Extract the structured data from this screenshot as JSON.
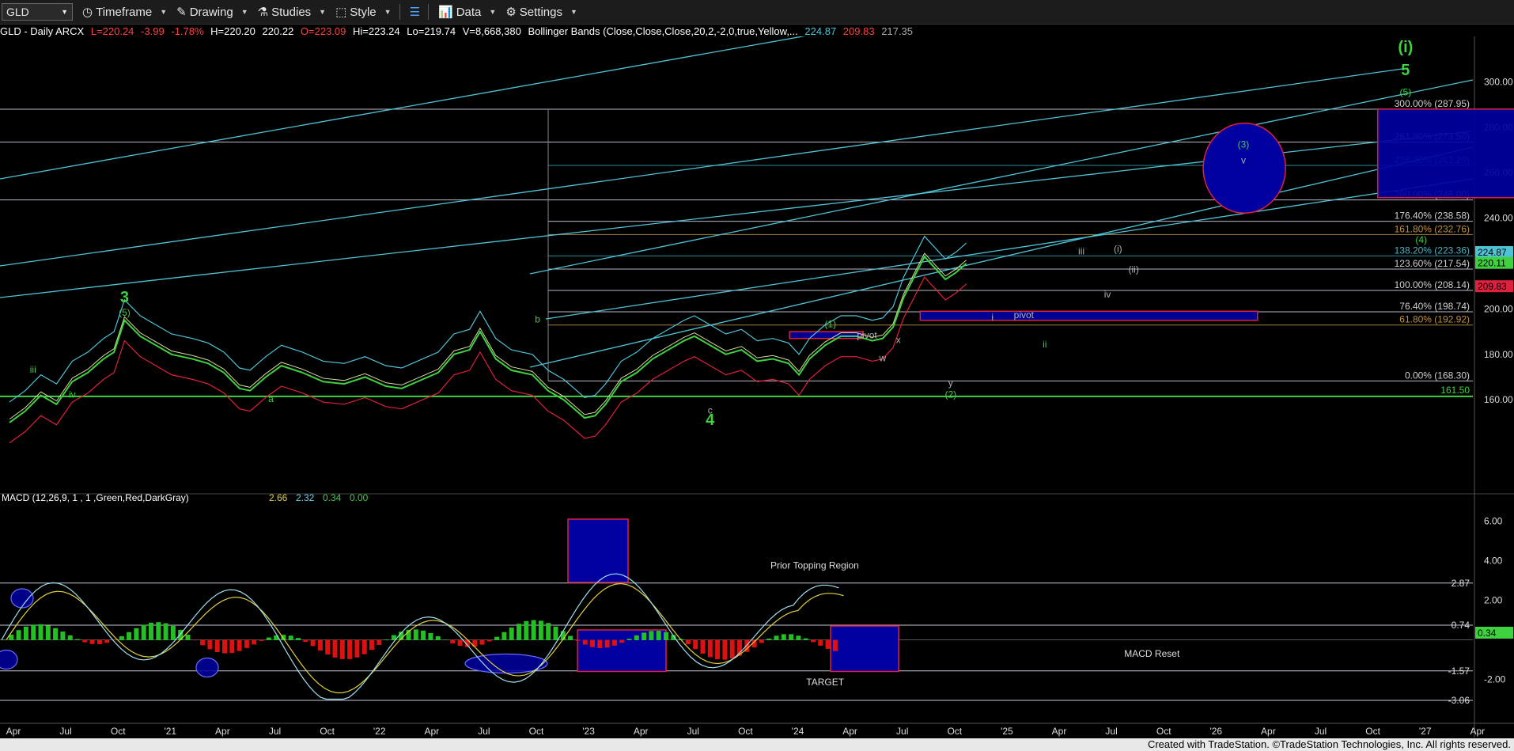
{
  "toolbar": {
    "symbol": "GLD",
    "timeframe": "Timeframe",
    "drawing": "Drawing",
    "studies": "Studies",
    "style": "Style",
    "data": "Data",
    "settings": "Settings"
  },
  "info": {
    "name": "GLD - Daily  ARCX",
    "last": "L=220.24",
    "chg": "-3.99",
    "pct": "-1.78%",
    "bid": "H=220.20",
    "ask": "220.22",
    "open": "O=223.09",
    "high": "Hi=223.24",
    "low": "Lo=219.74",
    "vol": "V=8,668,380",
    "bb": "Bollinger Bands (Close,Close,Close,20,2,-2,0,true,Yellow,...",
    "bb_up": "224.87",
    "bb_low": "209.83",
    "bb_mid": "217.35"
  },
  "footer": "Created with TradeStation. ©TradeStation Technologies, Inc. All rights reserved.",
  "colors": {
    "green": "#3fd13f",
    "cyan": "#4fc3d6",
    "blue": "#0000a0",
    "red": "#e0203c",
    "yellow": "#e0d040",
    "gray": "#b0b0b0"
  },
  "chart_data": [
    {
      "type": "line",
      "title": "",
      "ylim": [
        120,
        320
      ],
      "y_ticks": [
        160,
        180,
        200,
        220,
        240,
        260,
        280,
        300
      ],
      "x_ticks": [
        "Apr",
        "Jul",
        "Oct",
        "'21",
        "Apr",
        "Jul",
        "Oct",
        "'22",
        "Apr",
        "Jul",
        "Oct",
        "'23",
        "Apr",
        "Jul",
        "Oct",
        "'24",
        "Apr",
        "Jul",
        "Oct",
        "'25",
        "Apr",
        "Jul",
        "Oct",
        "'26",
        "Apr",
        "Jul",
        "Oct",
        "'27",
        "Apr"
      ],
      "fib_levels": [
        {
          "pct": "300.00%",
          "value": 287.95,
          "label": "300.00% (287.95)"
        },
        {
          "pct": "261.80%",
          "value": 273.5,
          "label": "261.80% (273.50)"
        },
        {
          "pct": "238.20%",
          "value": 263.2,
          "label": "238.20% (263.20)"
        },
        {
          "pct": "200.00%",
          "value": 248.0,
          "label": "200.00% (248.00)"
        },
        {
          "pct": "176.40%",
          "value": 238.58,
          "label": "176.40% (238.58)"
        },
        {
          "pct": "161.80%",
          "value": 232.76,
          "label": "161.80% (232.76)"
        },
        {
          "pct": "138.20%",
          "value": 223.36,
          "label": "138.20% (223.36)"
        },
        {
          "pct": "123.60%",
          "value": 217.54,
          "label": "123.60% (217.54)"
        },
        {
          "pct": "100.00%",
          "value": 208.14,
          "label": "100.00% (208.14)"
        },
        {
          "pct": "76.40%",
          "value": 198.74,
          "label": "76.40% (198.74)"
        },
        {
          "pct": "61.80%",
          "value": 192.92,
          "label": "61.80% (192.92)"
        },
        {
          "pct": "0.00%",
          "value": 168.3,
          "label": "0.00% (168.30)"
        }
      ],
      "support_line": {
        "value": 161.5,
        "label": "161.50"
      },
      "price_badges": [
        {
          "value": 224.87,
          "label": "224.87",
          "color": "#4fc3d6"
        },
        {
          "value": 220.11,
          "label": "220.11",
          "color": "#3fd13f"
        },
        {
          "value": 209.83,
          "label": "209.83",
          "color": "#e0203c"
        }
      ],
      "series": [
        {
          "values": [
            [
              0.0,
              150
            ],
            [
              0.3,
              155
            ],
            [
              0.6,
              162
            ],
            [
              0.9,
              158
            ],
            [
              1.2,
              168
            ],
            [
              1.5,
              172
            ],
            [
              1.8,
              178
            ],
            [
              2.0,
              181
            ],
            [
              2.2,
              195
            ],
            [
              2.5,
              188
            ],
            [
              2.8,
              184
            ],
            [
              3.1,
              180
            ],
            [
              3.5,
              178
            ],
            [
              3.8,
              176
            ],
            [
              4.1,
              172
            ],
            [
              4.4,
              165
            ],
            [
              4.6,
              164
            ],
            [
              4.9,
              170
            ],
            [
              5.2,
              175
            ],
            [
              5.6,
              172
            ],
            [
              6.0,
              168
            ],
            [
              6.4,
              167
            ],
            [
              6.8,
              170
            ],
            [
              7.2,
              166
            ],
            [
              7.5,
              165
            ],
            [
              7.8,
              168
            ],
            [
              8.2,
              172
            ],
            [
              8.5,
              180
            ],
            [
              8.8,
              182
            ],
            [
              9.0,
              190
            ],
            [
              9.3,
              178
            ],
            [
              9.6,
              173
            ],
            [
              10.0,
              171
            ],
            [
              10.3,
              164
            ],
            [
              10.6,
              160
            ],
            [
              10.8,
              156
            ],
            [
              11.0,
              152
            ],
            [
              11.2,
              153
            ],
            [
              11.4,
              158
            ],
            [
              11.7,
              168
            ],
            [
              12.0,
              172
            ],
            [
              12.3,
              178
            ],
            [
              12.6,
              182
            ],
            [
              12.9,
              186
            ],
            [
              13.1,
              188
            ],
            [
              13.4,
              184
            ],
            [
              13.7,
              180
            ],
            [
              14.0,
              182
            ],
            [
              14.3,
              177
            ],
            [
              14.6,
              178
            ],
            [
              14.9,
              176
            ],
            [
              15.1,
              171
            ],
            [
              15.3,
              178
            ],
            [
              15.6,
              184
            ],
            [
              15.9,
              188
            ],
            [
              16.2,
              188
            ],
            [
              16.5,
              186
            ],
            [
              16.7,
              187
            ],
            [
              16.9,
              192
            ],
            [
              17.1,
              205
            ],
            [
              17.3,
              214
            ],
            [
              17.5,
              223
            ],
            [
              17.7,
              218
            ],
            [
              17.9,
              213
            ],
            [
              18.1,
              216
            ],
            [
              18.3,
              220
            ]
          ]
        }
      ],
      "annotations": [
        {
          "text": "(i)",
          "color": "#3fd13f",
          "size": "big",
          "x": 26.7,
          "y": 313
        },
        {
          "text": "5",
          "color": "#3fd13f",
          "size": "big",
          "x": 26.7,
          "y": 303
        },
        {
          "text": "(5)",
          "color": "#3fd13f",
          "x": 26.7,
          "y": 294
        },
        {
          "text": "3",
          "color": "#3fd13f",
          "size": "big",
          "x": 2.2,
          "y": 203
        },
        {
          "text": "(5)",
          "color": "#3fd13f",
          "x": 2.2,
          "y": 197
        },
        {
          "text": "iii",
          "color": "#3fd13f",
          "x": 0.45,
          "y": 172
        },
        {
          "text": "iv",
          "color": "#3fd13f",
          "x": 1.2,
          "y": 161
        },
        {
          "text": "a",
          "color": "#3fd13f",
          "x": 5.0,
          "y": 159
        },
        {
          "text": "b",
          "color": "#3fd13f",
          "x": 10.1,
          "y": 194
        },
        {
          "text": "c",
          "color": "#b0b0b0",
          "x": 13.4,
          "y": 154
        },
        {
          "text": "4",
          "color": "#3fd13f",
          "size": "big",
          "x": 13.4,
          "y": 149
        },
        {
          "text": "(1)",
          "color": "#3fd13f",
          "x": 15.7,
          "y": 192
        },
        {
          "text": "pivot",
          "color": "#b0b0b0",
          "x": 16.4,
          "y": 187
        },
        {
          "text": "x",
          "color": "#b0b0b0",
          "x": 17.0,
          "y": 185
        },
        {
          "text": "w",
          "color": "#b0b0b0",
          "x": 16.7,
          "y": 177
        },
        {
          "text": "y",
          "color": "#b0b0b0",
          "x": 18.0,
          "y": 166
        },
        {
          "text": "(2)",
          "color": "#3fd13f",
          "x": 18.0,
          "y": 161
        },
        {
          "text": "i",
          "color": "#b0b0b0",
          "x": 18.8,
          "y": 195
        },
        {
          "text": "pivot",
          "color": "#b0b0b0",
          "x": 19.4,
          "y": 196
        },
        {
          "text": "ii",
          "color": "#3fd13f",
          "x": 19.8,
          "y": 183
        },
        {
          "text": "iii",
          "color": "#b0b0b0",
          "x": 20.5,
          "y": 224
        },
        {
          "text": "(i)",
          "color": "#b0b0b0",
          "x": 21.2,
          "y": 225
        },
        {
          "text": "(ii)",
          "color": "#b0b0b0",
          "x": 21.5,
          "y": 216
        },
        {
          "text": "iv",
          "color": "#b0b0b0",
          "x": 21.0,
          "y": 205
        },
        {
          "text": "(3)",
          "color": "#3fd13f",
          "x": 23.6,
          "y": 271
        },
        {
          "text": "v",
          "color": "#b0b0b0",
          "x": 23.6,
          "y": 264
        },
        {
          "text": "(4)",
          "color": "#3fd13f",
          "x": 27.0,
          "y": 229
        }
      ],
      "zones": [
        {
          "x0": 26.35,
          "x1": 30.95,
          "y0": 249,
          "y1": 288,
          "label": ""
        },
        {
          "x0": 17.6,
          "x1": 24.05,
          "y0": 195,
          "y1": 199,
          "label": ""
        },
        {
          "x0": 15.1,
          "x1": 16.5,
          "y0": 187,
          "y1": 190,
          "label": ""
        }
      ],
      "target_circle": {
        "cx": 23.8,
        "cy": 262,
        "rx": 1.05,
        "ry": 12
      }
    },
    {
      "type": "line",
      "title": "MACD (12,26,9, 1 , 1 ,Green,Red,DarkGray)",
      "legend_values": [
        "2.66",
        "2.32",
        "0.34",
        "0.00"
      ],
      "ylim": [
        -3.5,
        6.5
      ],
      "y_ticks": [
        6.0,
        4.0,
        2.0,
        -2.0
      ],
      "levels": [
        {
          "value": 2.87,
          "label": "2.87"
        },
        {
          "value": 0.74,
          "label": "0.74"
        },
        {
          "value": -1.57,
          "label": "-1.57"
        },
        {
          "value": -3.06,
          "label": "-3.06"
        }
      ],
      "badge": {
        "value": 0.34,
        "label": "0.34"
      },
      "notes": [
        {
          "text": "Prior Topping Region",
          "x": 15.4,
          "y": 3.6
        },
        {
          "text": "TARGET",
          "x": 15.6,
          "y": -2.3
        },
        {
          "text": "MACD Reset",
          "x": 21.85,
          "y": -0.85
        }
      ]
    }
  ]
}
